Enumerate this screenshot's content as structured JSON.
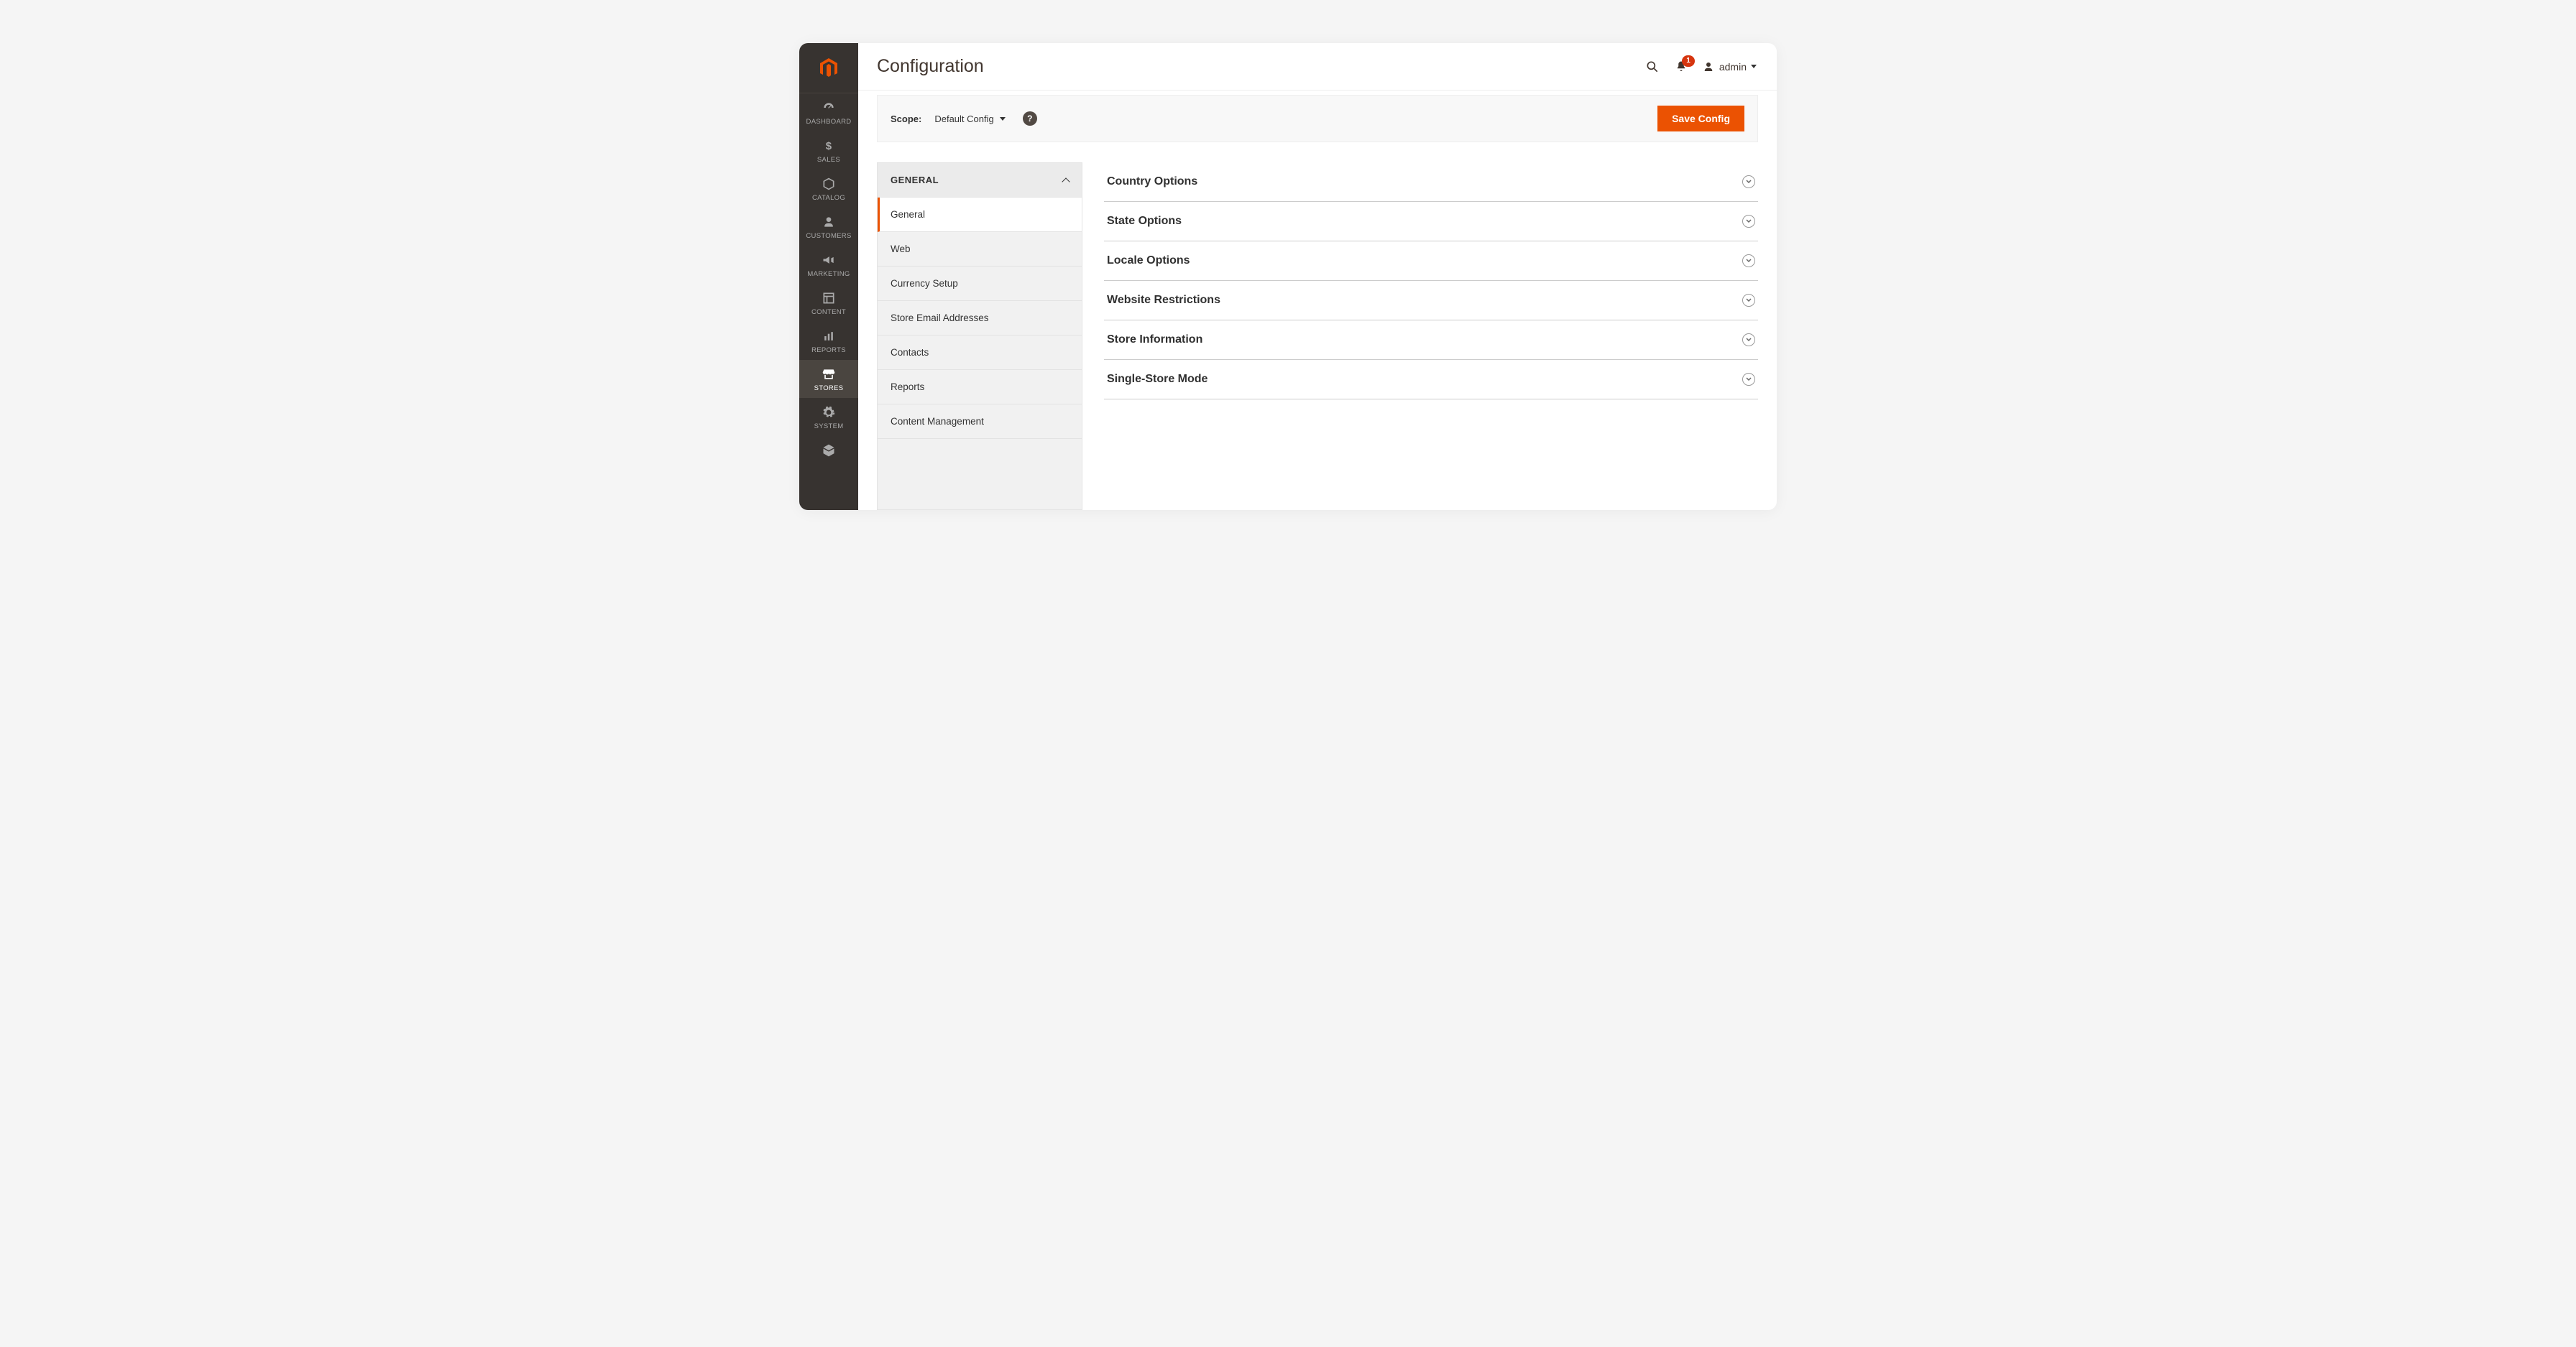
{
  "page_title": "Configuration",
  "notification_count": "1",
  "user_name": "admin",
  "scope": {
    "label": "Scope:",
    "value": "Default Config"
  },
  "save_button": "Save Config",
  "sidebar_nav": [
    {
      "label": "DASHBOARD",
      "icon": "dashboard"
    },
    {
      "label": "SALES",
      "icon": "dollar"
    },
    {
      "label": "CATALOG",
      "icon": "box"
    },
    {
      "label": "CUSTOMERS",
      "icon": "person"
    },
    {
      "label": "MARKETING",
      "icon": "megaphone"
    },
    {
      "label": "CONTENT",
      "icon": "layout"
    },
    {
      "label": "REPORTS",
      "icon": "bars"
    },
    {
      "label": "STORES",
      "icon": "storefront",
      "active": true
    },
    {
      "label": "SYSTEM",
      "icon": "gear"
    },
    {
      "label": "",
      "icon": "puzzle"
    }
  ],
  "config_group_title": "GENERAL",
  "config_subitems": [
    {
      "label": "General",
      "active": true
    },
    {
      "label": "Web"
    },
    {
      "label": "Currency Setup"
    },
    {
      "label": "Store Email Addresses"
    },
    {
      "label": "Contacts"
    },
    {
      "label": "Reports"
    },
    {
      "label": "Content Management"
    }
  ],
  "sections": [
    {
      "title": "Country Options"
    },
    {
      "title": "State Options"
    },
    {
      "title": "Locale Options"
    },
    {
      "title": "Website Restrictions"
    },
    {
      "title": "Store Information"
    },
    {
      "title": "Single-Store Mode"
    }
  ]
}
